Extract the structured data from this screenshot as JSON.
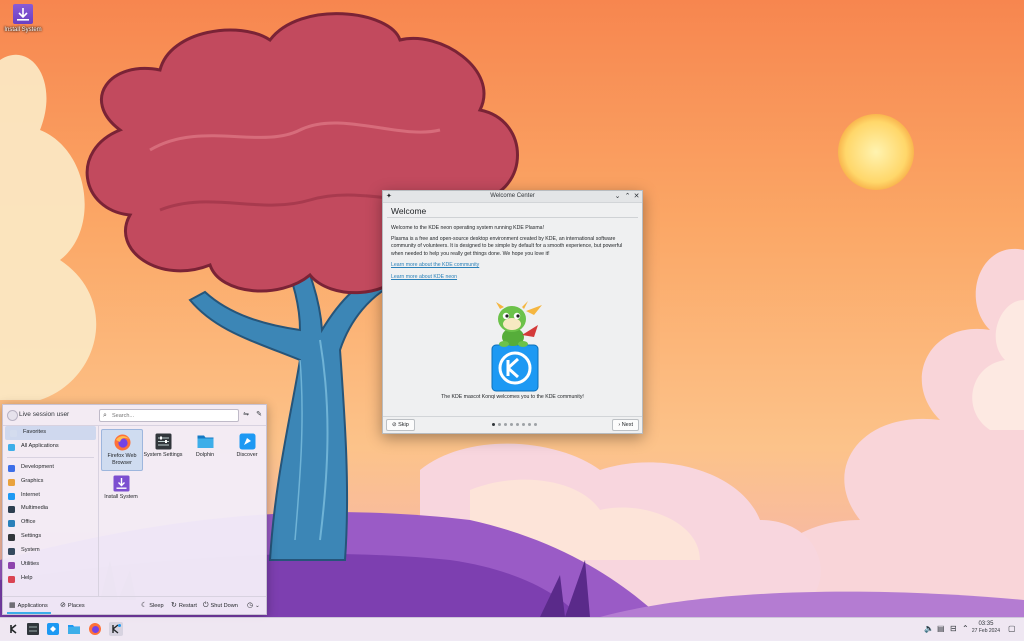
{
  "desktop": {
    "icon_label": "Install System"
  },
  "welcome": {
    "window_title": "Welcome Center",
    "heading": "Welcome",
    "intro": "Welcome to the KDE neon operating system running KDE Plasma!",
    "description": "Plasma is a free and open-source desktop environment created by KDE, an international software community of volunteers. It is designed to be simple by default for a smooth experience, but powerful when needed to help you really get things done. We hope you love it!",
    "link_community": "Learn more about the KDE community",
    "link_neon": "Learn more about KDE neon",
    "caption": "The KDE mascot Konqi welcomes you to the KDE community!",
    "skip_label": "Skip",
    "next_label": "Next",
    "page_index": 1,
    "page_count": 8
  },
  "launcher": {
    "user_name": "Live session user",
    "search_placeholder": "Search...",
    "categories": [
      {
        "label": "Favorites",
        "icon": "star-icon",
        "color": "#d4dcee"
      },
      {
        "label": "All Applications",
        "icon": "grid-icon",
        "color": "#3daee9"
      },
      {
        "label": "Development",
        "icon": "code-icon",
        "color": "#3d6fe9"
      },
      {
        "label": "Graphics",
        "icon": "palette-icon",
        "color": "#e9a23d"
      },
      {
        "label": "Internet",
        "icon": "globe-icon",
        "color": "#1d99f3"
      },
      {
        "label": "Multimedia",
        "icon": "media-icon",
        "color": "#2c3e50"
      },
      {
        "label": "Office",
        "icon": "office-icon",
        "color": "#2980b9"
      },
      {
        "label": "Settings",
        "icon": "settings-icon",
        "color": "#31363b"
      },
      {
        "label": "System",
        "icon": "system-icon",
        "color": "#34495e"
      },
      {
        "label": "Utilities",
        "icon": "utilities-icon",
        "color": "#8e44ad"
      },
      {
        "label": "Help",
        "icon": "help-icon",
        "color": "#da4453"
      }
    ],
    "apps": [
      {
        "label": "Firefox Web Browser",
        "icon": "firefox-icon"
      },
      {
        "label": "System Settings",
        "icon": "system-settings-icon"
      },
      {
        "label": "Dolphin",
        "icon": "folder-icon"
      },
      {
        "label": "Discover",
        "icon": "discover-icon"
      },
      {
        "label": "Install System",
        "icon": "install-icon"
      }
    ],
    "tabs": {
      "applications": "Applications",
      "places": "Places"
    },
    "power": {
      "sleep": "Sleep",
      "restart": "Restart",
      "shutdown": "Shut Down"
    }
  },
  "taskbar": {
    "time": "03:35",
    "date": "27 Feb 2024"
  }
}
